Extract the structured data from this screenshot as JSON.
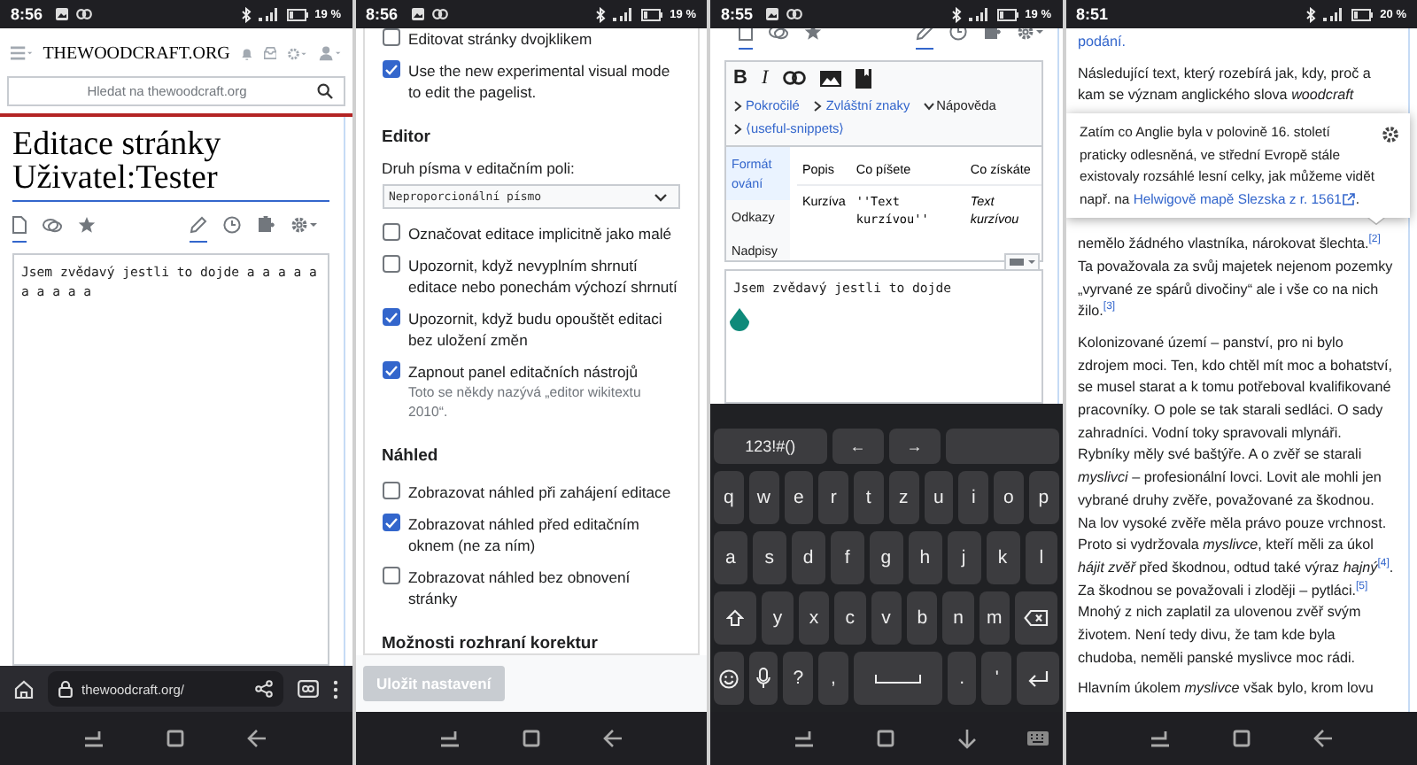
{
  "screens": [
    {
      "kind": "edit_page",
      "status_bar": {
        "time": "8:56",
        "notifications": true,
        "battery": "19 %"
      },
      "site_logo": "THEWOODCRAFT.ORG",
      "search": {
        "placeholder": "Hledat na thewoodcraft.org"
      },
      "heading": "Editace stránky Uživatel:Tester",
      "page_tabs": [
        {
          "kind": "page",
          "selected": true
        },
        {
          "kind": "talk",
          "selected": false
        },
        {
          "kind": "star",
          "selected": false
        },
        {
          "kind": "edit",
          "selected": true
        },
        {
          "kind": "history",
          "selected": false
        },
        {
          "kind": "puzzle",
          "selected": false
        },
        {
          "kind": "settings",
          "selected": false
        }
      ],
      "editor": {
        "value": "Jsem zvědavý jestli to dojde a a a a a a a a a a"
      },
      "browser_bar": {
        "url": "thewoodcraft.org/"
      },
      "nav_bar": {
        "keyboard_open": false
      }
    },
    {
      "kind": "preferences",
      "status_bar": {
        "time": "8:56",
        "notifications": true,
        "battery": "19 %"
      },
      "items": [
        {
          "kind": "checkbox",
          "label": "Editovat stránky dvojklikem",
          "checked": false
        },
        {
          "kind": "checkbox",
          "label": "Use the new experimental visual mode to edit the pagelist.",
          "checked": true
        },
        {
          "kind": "heading",
          "label": "Editor"
        },
        {
          "kind": "field_label",
          "label": "Druh písma v editačním poli:"
        },
        {
          "kind": "select",
          "value": "Neproporcionální písmo"
        },
        {
          "kind": "checkbox",
          "label": "Označovat editace implicitně jako malé",
          "checked": false
        },
        {
          "kind": "checkbox",
          "label": "Upozornit, když nevyplním shrnutí editace nebo ponechám výchozí shrnutí",
          "checked": false
        },
        {
          "kind": "checkbox",
          "label": "Upozornit, když budu opouštět editaci bez uložení změn",
          "checked": true
        },
        {
          "kind": "checkbox",
          "label": "Zapnout panel editačních nástrojů",
          "hint": "Toto se někdy nazývá „editor wikitextu 2010“.",
          "checked": true
        },
        {
          "kind": "heading",
          "label": "Náhled"
        },
        {
          "kind": "checkbox",
          "label": "Zobrazovat náhled při zahájení editace",
          "checked": false
        },
        {
          "kind": "checkbox",
          "label": "Zobrazovat náhled před editačním oknem (ne za ním)",
          "checked": true
        },
        {
          "kind": "checkbox",
          "label": "Zobrazovat náhled bez obnovení stránky",
          "checked": false
        },
        {
          "kind": "heading",
          "label": "Možnosti rozhraní korektur"
        }
      ],
      "save_button": {
        "label": "Uložit nastavení",
        "disabled": true
      },
      "nav_bar": {
        "keyboard_open": false
      }
    },
    {
      "kind": "editor_keyboard",
      "status_bar": {
        "time": "8:55",
        "notifications": true,
        "battery": "19 %"
      },
      "page_tabs": [
        {
          "kind": "page",
          "selected": true
        },
        {
          "kind": "talk",
          "selected": false
        },
        {
          "kind": "star",
          "selected": false
        },
        {
          "kind": "edit",
          "selected": true
        },
        {
          "kind": "history",
          "selected": false
        },
        {
          "kind": "puzzle",
          "selected": false
        },
        {
          "kind": "settings",
          "selected": false
        }
      ],
      "toolbar": [
        {
          "kind": "bold",
          "label": "B"
        },
        {
          "kind": "italic",
          "label": "I"
        },
        {
          "kind": "link"
        },
        {
          "kind": "image"
        },
        {
          "kind": "book"
        }
      ],
      "sections": [
        {
          "label": "Pokročilé",
          "expanded": false
        },
        {
          "label": "Zvláštní znaky",
          "expanded": false
        },
        {
          "label": "Nápověda",
          "expanded": true
        },
        {
          "label": "⟨useful-snippets⟩",
          "expanded": false
        }
      ],
      "help": {
        "tabs": [
          {
            "label": "Formát ování",
            "selected": true
          },
          {
            "label": "Odkazy",
            "selected": false
          },
          {
            "label": "Nadpisy",
            "selected": false
          }
        ],
        "columns": [
          "Popis",
          "Co píšete",
          "Co získáte"
        ],
        "rows": [
          [
            "Kurzíva",
            "''Text kurzívou''",
            "Text kurzívou"
          ]
        ]
      },
      "editor": {
        "value": "Jsem zvědavý jestli to dojde"
      },
      "keyboard": [
        [
          {
            "kind": "char",
            "label": "123!#()"
          },
          {
            "kind": "char",
            "label": "←"
          },
          {
            "kind": "char",
            "label": "→"
          },
          {
            "kind": "blank"
          }
        ],
        [
          {
            "kind": "char",
            "label": "q"
          },
          {
            "kind": "char",
            "label": "w"
          },
          {
            "kind": "char",
            "label": "e"
          },
          {
            "kind": "char",
            "label": "r"
          },
          {
            "kind": "char",
            "label": "t"
          },
          {
            "kind": "char",
            "label": "z"
          },
          {
            "kind": "char",
            "label": "u"
          },
          {
            "kind": "char",
            "label": "i"
          },
          {
            "kind": "char",
            "label": "o"
          },
          {
            "kind": "char",
            "label": "p"
          }
        ],
        [
          {
            "kind": "char",
            "label": "a"
          },
          {
            "kind": "char",
            "label": "s"
          },
          {
            "kind": "char",
            "label": "d"
          },
          {
            "kind": "char",
            "label": "f"
          },
          {
            "kind": "char",
            "label": "g"
          },
          {
            "kind": "char",
            "label": "h"
          },
          {
            "kind": "char",
            "label": "j"
          },
          {
            "kind": "char",
            "label": "k"
          },
          {
            "kind": "char",
            "label": "l"
          }
        ],
        [
          {
            "kind": "shift"
          },
          {
            "kind": "char",
            "label": "y"
          },
          {
            "kind": "char",
            "label": "x"
          },
          {
            "kind": "char",
            "label": "c"
          },
          {
            "kind": "char",
            "label": "v"
          },
          {
            "kind": "char",
            "label": "b"
          },
          {
            "kind": "char",
            "label": "n"
          },
          {
            "kind": "char",
            "label": "m"
          },
          {
            "kind": "backspace"
          }
        ],
        [
          {
            "kind": "emoji"
          },
          {
            "kind": "mic"
          },
          {
            "kind": "char",
            "label": "?"
          },
          {
            "kind": "char",
            "label": ","
          },
          {
            "kind": "space"
          },
          {
            "kind": "char",
            "label": "."
          },
          {
            "kind": "char",
            "label": "'"
          },
          {
            "kind": "enter"
          }
        ]
      ],
      "nav_bar": {
        "keyboard_open": true
      }
    },
    {
      "kind": "article",
      "status_bar": {
        "time": "8:51",
        "notifications": false,
        "battery": "20 %"
      },
      "lead_link": "podání.",
      "paragraph_top": "Následující text, který rozebírá jak, kdy, proč a kam se význam anglického slova *woodcraft*",
      "paragraph_bottom": "nemělo žádného vlastníka, nárokovat šlechta.$^{[2]}$ Ta považovala za svůj majetek nejenom pozemky „vyrvané ze spárů divočiny“ ale i vše co na nich žilo.$^{[3]}$",
      "paragraphs": [
        "Kolonizované území – panství, pro ni bylo zdrojem moci. Ten, kdo chtěl mít moc a bohatství, se musel starat a k tomu potřeboval kvalifikované pracovníky. O pole se tak starali sedláci. O sady zahradníci. Vodní toky spravovali mlynáři. Rybníky měly své baštýře. A o zvěř se starali *myslivci* – profesionální lovci. Lovit ale mohli jen vybrané druhy zvěře, považované za škodnou. Na lov vysoké zvěře měla právo pouze vrchnost. Proto si vydržovala *myslivce*, kteří měli za úkol *hájit zvěř* před škodnou, odtud také výraz *hajný*$^{[4]}$. Za škodnou se považovali i zloději – pytláci.$^{[5]}$ Mnohý z nich zaplatil za ulovenou zvěř svým životem. Není tedy divu, že tam kde byla chudoba, neměli panské myslivce moc rádi.",
        "Hlavním úkolem *myslivce* však bylo, krom lovu"
      ],
      "popup": {
        "text": "Zatím co Anglie byla v polovině 16. století praticky odlesněná, ve střední Evropě stále existovaly rozsáhlé lesní celky, jak můžeme vidět např. na",
        "link": "Helwigově mapě Slezska z r. 1561",
        "tail": "."
      },
      "nav_bar": {
        "keyboard_open": false
      }
    }
  ]
}
